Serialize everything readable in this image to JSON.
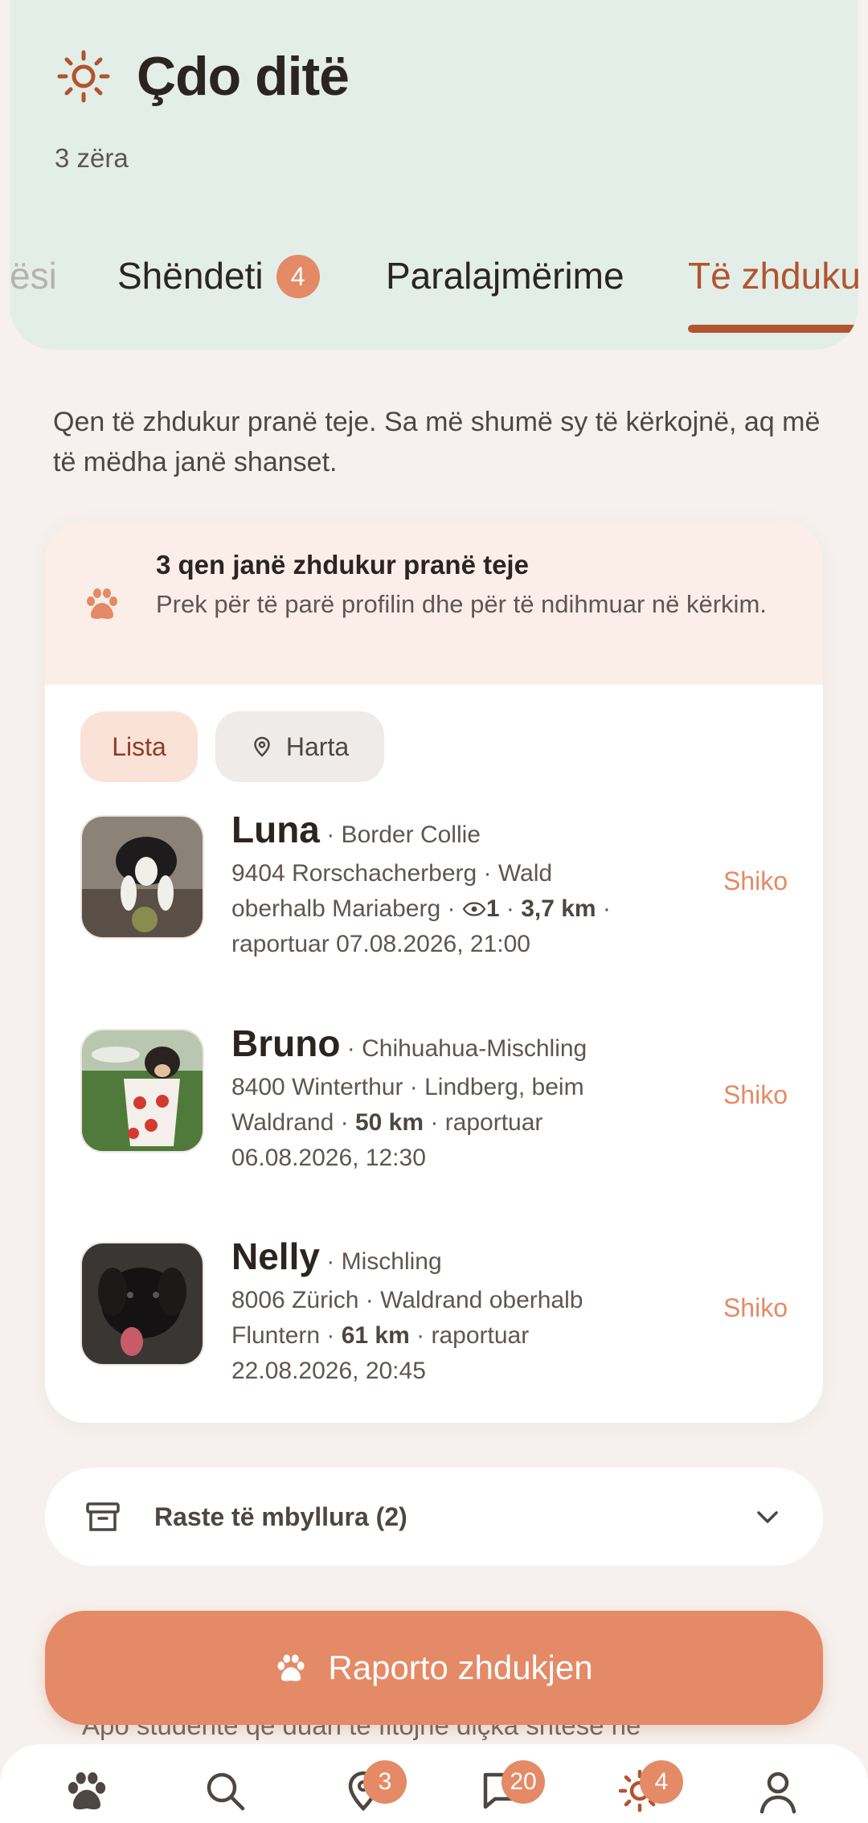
{
  "header": {
    "title": "Çdo ditë",
    "subtitle": "3 zëra",
    "tabs": [
      {
        "label": "ësi",
        "state": "faded"
      },
      {
        "label": "Shëndeti",
        "badge": "4"
      },
      {
        "label": "Paralajmërime"
      },
      {
        "label": "Të zhduku",
        "state": "active"
      }
    ]
  },
  "intro": "Qen të zhdukur pranë teje. Sa më shumë sy të kërkojnë, aq më të mëdha janë shanset.",
  "alert": {
    "title": "3 qen janë zhdukur pranë teje",
    "text": "Prek për të parë profilin dhe për të ndihmuar në kërkim."
  },
  "view_toggle": {
    "list": "Lista",
    "map": "Harta",
    "selected": "Lista"
  },
  "dogs": [
    {
      "name": "Luna",
      "breed": "· Border Collie",
      "loc1": "9404 Rorschacherberg · Wald",
      "loc2": "oberhalb Mariaberg ·",
      "views": "1",
      "sep1": " · ",
      "distance": "3,7 km",
      "sep2": " ·",
      "reported": "raportuar 07.08.2026, 21:00",
      "action": "Shiko"
    },
    {
      "name": "Bruno",
      "breed": "· Chihuahua-Mischling",
      "loc1": "8400 Winterthur · Lindberg, beim",
      "loc2": "Waldrand · ",
      "distance": "50 km",
      "after": " · raportuar",
      "reported": "06.08.2026, 12:30",
      "action": "Shiko"
    },
    {
      "name": "Nelly",
      "breed": "· Mischling",
      "loc1": "8006 Zürich · Waldrand oberhalb",
      "loc2": "Fluntern · ",
      "distance": "61 km",
      "after": " · raportuar",
      "reported": "22.08.2026, 20:45",
      "action": "Shiko"
    }
  ],
  "closed_cases": {
    "label": "Raste të mbyllura (2)"
  },
  "cta": {
    "label": "Raporto zhdukjen"
  },
  "peek_text": "Apo studentë që duan të fitojnë diçka shtesë në",
  "bottom_nav": [
    {
      "icon": "paw-icon"
    },
    {
      "icon": "search-icon"
    },
    {
      "icon": "location-pin-icon",
      "badge": "3"
    },
    {
      "icon": "chat-icon",
      "badge": "20"
    },
    {
      "icon": "sun-icon",
      "badge": "4"
    },
    {
      "icon": "profile-icon"
    }
  ],
  "colors": {
    "accent": "#e48a66",
    "active_tab": "#b2542e",
    "header_bg": "#e3eee9"
  }
}
